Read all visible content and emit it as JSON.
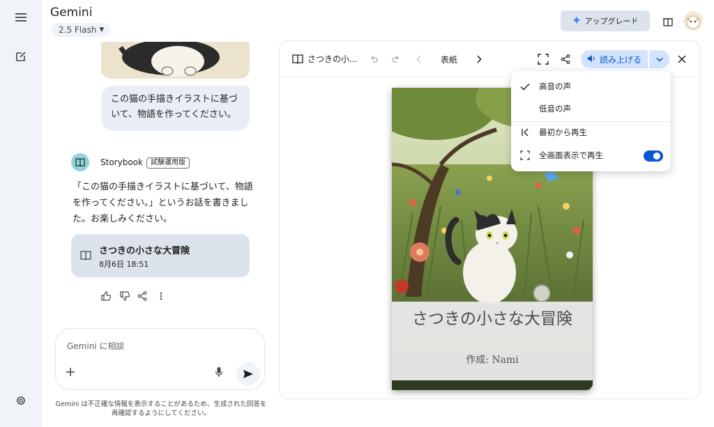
{
  "header": {
    "title": "Gemini",
    "model": "2.5 Flash",
    "upgrade_label": "アップグレード"
  },
  "chat": {
    "user_message": "この猫の手描きイラストに基づいて、物語を作ってください。",
    "agent_name": "Storybook",
    "agent_badge": "試験運用版",
    "reply_text": "「この猫の手描きイラストに基づいて、物語を作ってください。」というお話を書きました。お楽しみください。",
    "story_card": {
      "title": "さつきの小さな大冒険",
      "date": "8月6日 18:51"
    }
  },
  "input": {
    "placeholder": "Gemini に相談"
  },
  "disclaimer": "Gemini は不正確な情報を表示することがあるため、生成された回答を再確認するようにしてください。",
  "viewer": {
    "title": "さつきの小...",
    "page_label": "表紙",
    "read_label": "読み上げる",
    "book": {
      "title": "さつきの小さな大冒険",
      "author": "作成: Nami"
    }
  },
  "menu": {
    "items": [
      {
        "label": "高音の声",
        "checked": true
      },
      {
        "label": "低音の声",
        "checked": false
      },
      {
        "label": "最初から再生"
      },
      {
        "label": "全画面表示で再生",
        "toggle_on": true
      }
    ]
  },
  "colors": {
    "accent": "#0b57d0",
    "accent_bg": "#d3e3fd",
    "rail_bg": "#f0f4f9",
    "bubble_bg": "#e9eef6",
    "card_bg": "#dde3ea"
  }
}
